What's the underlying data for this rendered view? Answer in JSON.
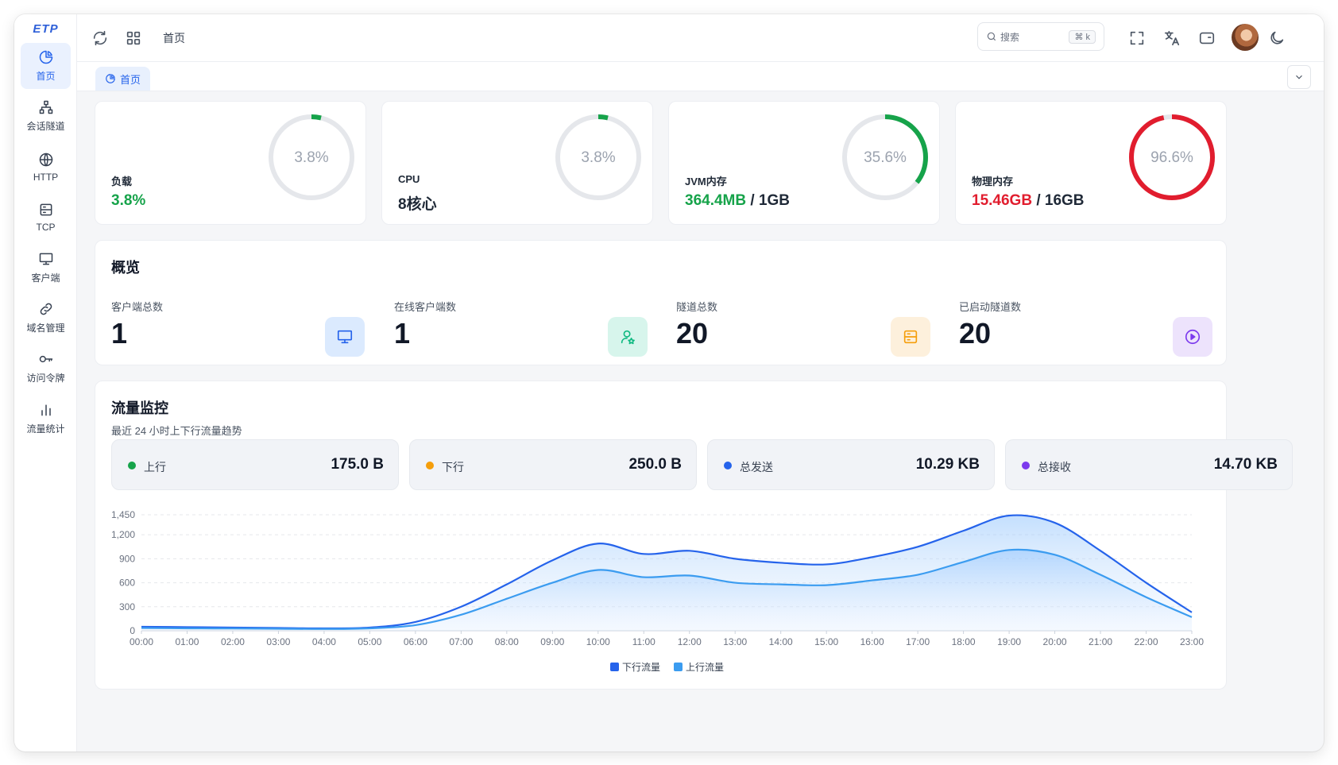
{
  "sidebar": {
    "logo": "ETP",
    "items": [
      {
        "label": "首页",
        "icon": "pie-chart-icon",
        "active": true
      },
      {
        "label": "会话隧道",
        "icon": "network-icon",
        "active": false
      },
      {
        "label": "HTTP",
        "icon": "globe-icon",
        "active": false
      },
      {
        "label": "TCP",
        "icon": "server-icon",
        "active": false
      },
      {
        "label": "客户端",
        "icon": "monitor-icon",
        "active": false
      },
      {
        "label": "域名管理",
        "icon": "link-icon",
        "active": false
      },
      {
        "label": "访问令牌",
        "icon": "key-icon",
        "active": false
      },
      {
        "label": "流量统计",
        "icon": "bar-chart-icon",
        "active": false
      }
    ]
  },
  "header": {
    "title": "首页",
    "search_placeholder": "搜索",
    "search_shortcut": "⌘ k"
  },
  "tabs": [
    {
      "label": "首页",
      "active": true
    }
  ],
  "stats": [
    {
      "label": "负载",
      "value": "3.8%",
      "percent": 3.8,
      "percent_text": "3.8%",
      "ring_color": "#16a34a"
    },
    {
      "label": "CPU",
      "value": "8核心",
      "percent": 3.8,
      "percent_text": "3.8%",
      "ring_color": "#16a34a"
    },
    {
      "label": "JVM内存",
      "value_used": "364.4MB",
      "value_sep": " / ",
      "value_total": "1GB",
      "percent": 35.6,
      "percent_text": "35.6%",
      "ring_color": "#16a34a"
    },
    {
      "label": "物理内存",
      "value_used": "15.46GB",
      "value_sep": " / ",
      "value_total": "16GB",
      "percent": 96.6,
      "percent_text": "96.6%",
      "ring_color": "#e11d2e"
    }
  ],
  "overview": {
    "title": "概览",
    "items": [
      {
        "label": "客户端总数",
        "value": "1",
        "icon": "monitor-icon",
        "bg": "#dbeafe",
        "color": "#2563eb"
      },
      {
        "label": "在线客户端数",
        "value": "1",
        "icon": "user-star-icon",
        "bg": "#d7f5ec",
        "color": "#10b981"
      },
      {
        "label": "隧道总数",
        "value": "20",
        "icon": "server-icon",
        "bg": "#fdf0dc",
        "color": "#f59e0b"
      },
      {
        "label": "已启动隧道数",
        "value": "20",
        "icon": "play-circle-icon",
        "bg": "#ede3fc",
        "color": "#7c3aed"
      }
    ]
  },
  "traffic": {
    "title": "流量监控",
    "subtitle": "最近 24 小时上下行流量趋势",
    "summary": [
      {
        "label": "上行",
        "value": "175.0 B",
        "dot": "#16a34a"
      },
      {
        "label": "下行",
        "value": "250.0 B",
        "dot": "#f59e0b"
      },
      {
        "label": "总发送",
        "value": "10.29 KB",
        "dot": "#2563eb"
      },
      {
        "label": "总接收",
        "value": "14.70 KB",
        "dot": "#7c3aed"
      }
    ]
  },
  "chart_data": {
    "type": "area",
    "x": [
      "00:00",
      "01:00",
      "02:00",
      "03:00",
      "04:00",
      "05:00",
      "06:00",
      "07:00",
      "08:00",
      "09:00",
      "10:00",
      "11:00",
      "12:00",
      "13:00",
      "14:00",
      "15:00",
      "16:00",
      "17:00",
      "18:00",
      "19:00",
      "20:00",
      "21:00",
      "22:00",
      "23:00"
    ],
    "y_ticks": [
      0,
      300,
      600,
      900,
      1200,
      1450
    ],
    "ylim": [
      0,
      1450
    ],
    "grid": true,
    "legend_position": "bottom-center",
    "series": [
      {
        "name": "下行流量",
        "color": "#2563eb",
        "values": [
          50,
          45,
          40,
          35,
          30,
          40,
          110,
          300,
          580,
          880,
          1090,
          960,
          1000,
          900,
          850,
          830,
          920,
          1050,
          1250,
          1440,
          1350,
          1000,
          600,
          230
        ]
      },
      {
        "name": "上行流量",
        "color": "#3b9cf0",
        "values": [
          35,
          30,
          28,
          25,
          22,
          30,
          70,
          200,
          400,
          600,
          760,
          670,
          690,
          600,
          580,
          570,
          630,
          700,
          860,
          1010,
          950,
          700,
          420,
          170
        ]
      }
    ]
  }
}
